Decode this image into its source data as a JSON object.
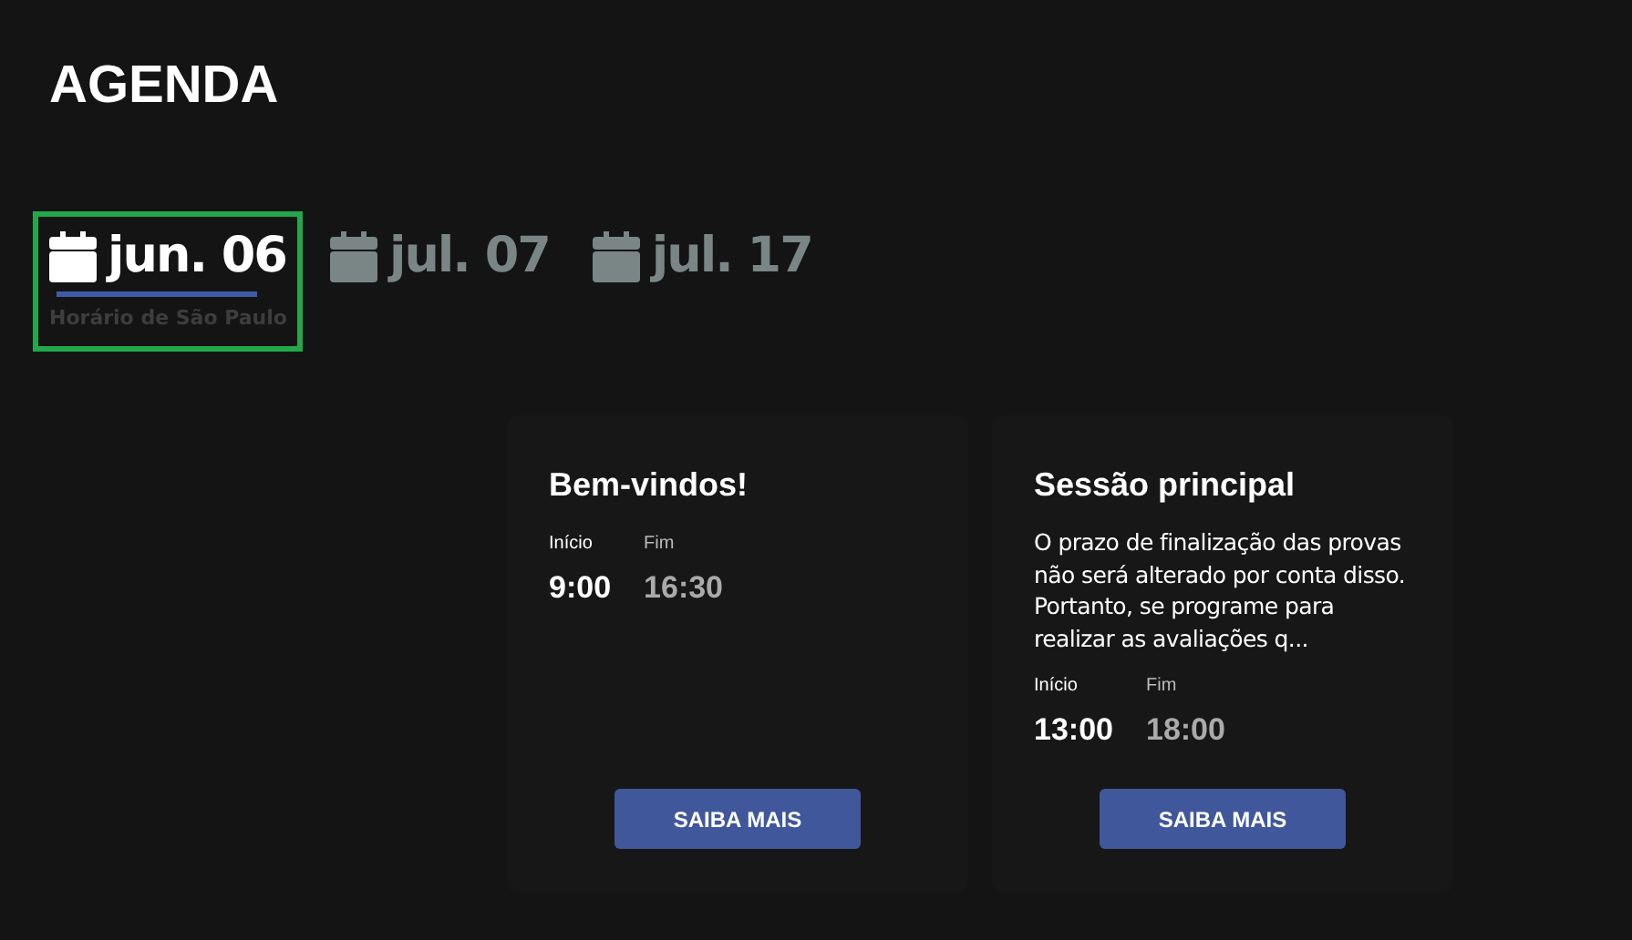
{
  "title": "AGENDA",
  "tabs": [
    {
      "label": "jun. 06",
      "selected": true,
      "note": "Horário de São Paulo"
    },
    {
      "label": "jul. 07",
      "selected": false
    },
    {
      "label": "jul. 17",
      "selected": false
    }
  ],
  "sessions": [
    {
      "title": "Bem-vindos!",
      "start_label": "Início",
      "start": "9:00",
      "end_label": "Fim",
      "end": "16:30",
      "button": "SAIBA MAIS"
    },
    {
      "title": "Sessão principal",
      "description": "O prazo de finalização das provas não será alterado por conta disso. Portanto, se programe para realizar as avaliações q...",
      "start_label": "Início",
      "start": "13:00",
      "end_label": "Fim",
      "end": "18:00",
      "button": "SAIBA MAIS"
    }
  ]
}
